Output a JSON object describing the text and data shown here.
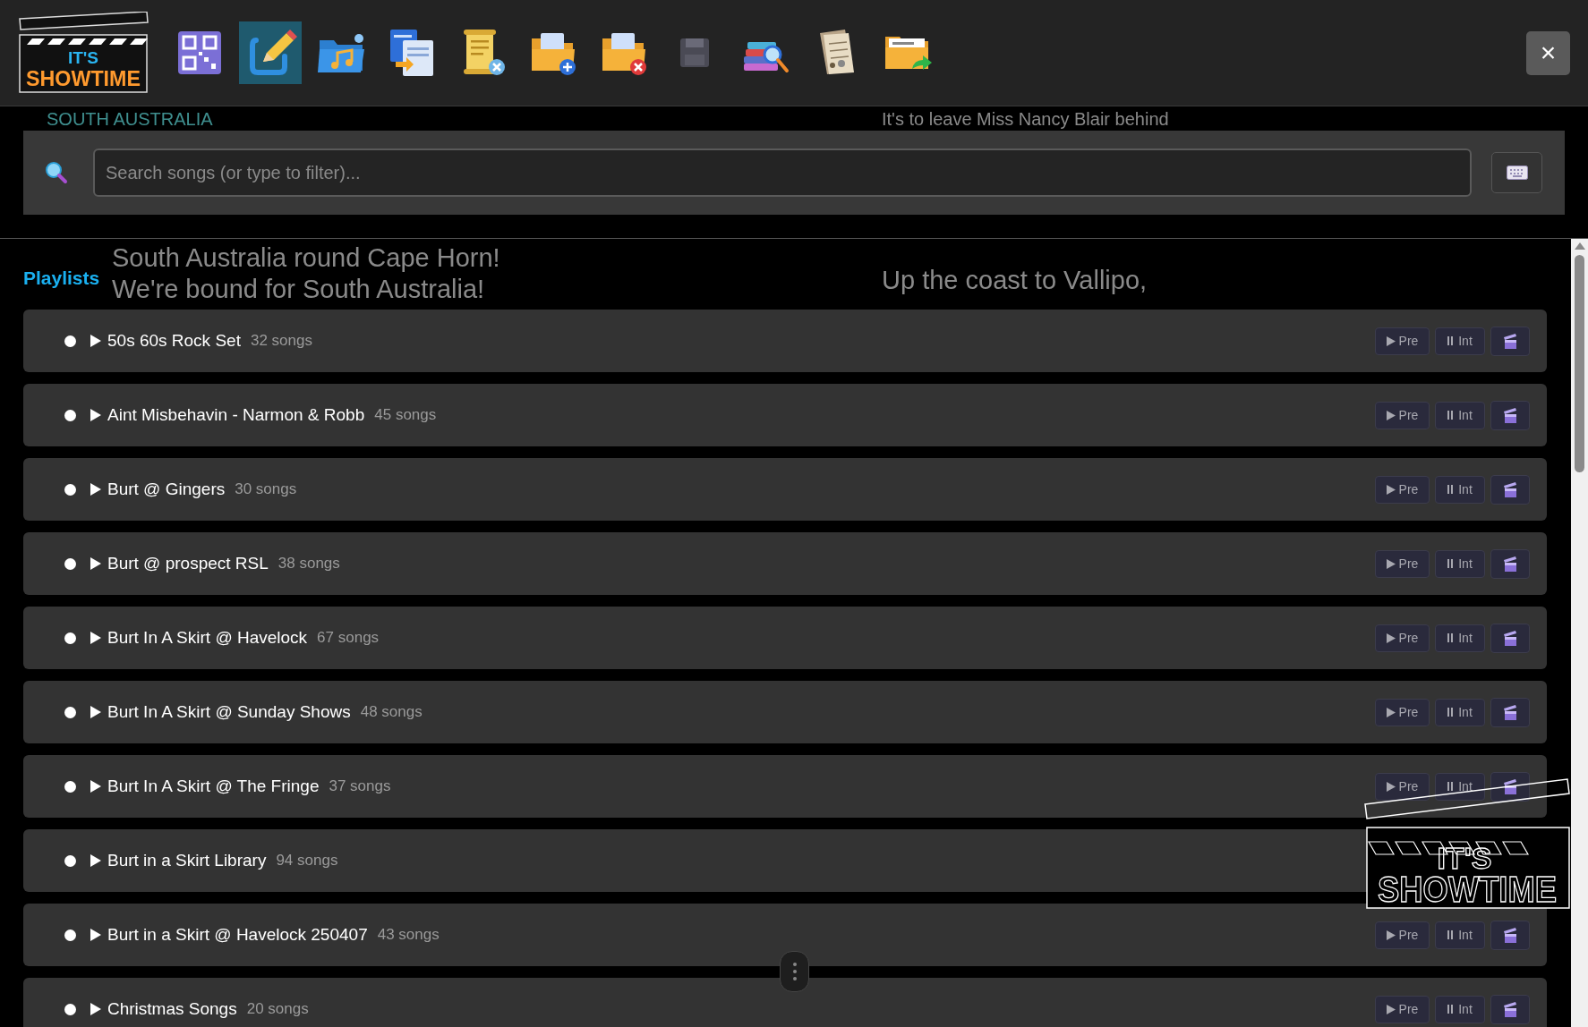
{
  "background_lyrics": [
    {
      "text": "SOUTH AUSTRALIA",
      "kind": "heading"
    },
    {
      "text": "It's to leave Miss Nancy Blair behind",
      "kind": "line"
    },
    {
      "text": "South Australia round Cape Horn!"
    },
    {
      "text": "We're bound for South Australia!"
    },
    {
      "text": "Up the coast to Vallipo,"
    }
  ],
  "toolbar": {
    "logo": {
      "line_1": "IT'S",
      "line_2": "SHOWTIME"
    },
    "buttons": [
      {
        "kind": "qr",
        "selected": false
      },
      {
        "kind": "pencil",
        "selected": true
      },
      {
        "kind": "music-folder",
        "selected": false
      },
      {
        "kind": "copy",
        "selected": false
      },
      {
        "kind": "scroll-delete",
        "selected": false
      },
      {
        "kind": "folder-add",
        "selected": false
      },
      {
        "kind": "folder-remove",
        "selected": false
      },
      {
        "kind": "floppy",
        "selected": false
      },
      {
        "kind": "books-search",
        "selected": false
      },
      {
        "kind": "sheet-music",
        "selected": false
      },
      {
        "kind": "folder-export",
        "selected": false
      }
    ],
    "close": "×"
  },
  "search": {
    "placeholder": "Search songs (or type to filter)..."
  },
  "playlists": {
    "title": "Playlists",
    "rows": [
      {
        "name": "50s 60s Rock Set",
        "count": "32 songs",
        "selected": false,
        "pre": "Pre",
        "int": "Int"
      },
      {
        "name": "Aint Misbehavin - Narmon & Robb",
        "count": "45 songs",
        "selected": false,
        "pre": "Pre",
        "int": "Int"
      },
      {
        "name": "Burt @ Gingers",
        "count": "30 songs",
        "selected": false,
        "pre": "Pre",
        "int": "Int"
      },
      {
        "name": "Burt @ prospect RSL",
        "count": "38 songs",
        "selected": false,
        "pre": "Pre",
        "int": "Int"
      },
      {
        "name": "Burt In A Skirt @ Havelock",
        "count": "67 songs",
        "selected": false,
        "pre": "Pre",
        "int": "Int"
      },
      {
        "name": "Burt In A Skirt @ Sunday Shows",
        "count": "48 songs",
        "selected": false,
        "pre": "Pre",
        "int": "Int"
      },
      {
        "name": "Burt In A Skirt @ The Fringe",
        "count": "37 songs",
        "selected": false,
        "pre": "Pre",
        "int": "Int"
      },
      {
        "name": "Burt in a Skirt Library",
        "count": "94 songs",
        "selected": false
      },
      {
        "name": "Burt in a Skirt @ Havelock 250407",
        "count": "43 songs",
        "selected": false,
        "pre": "Pre",
        "int": "Int"
      },
      {
        "name": "Christmas Songs",
        "count": "20 songs",
        "selected": false,
        "pre": "Pre",
        "int": "Int"
      }
    ]
  },
  "floating_logo": {
    "line_1": "IT'S",
    "line_2": "SHOWTIME"
  }
}
